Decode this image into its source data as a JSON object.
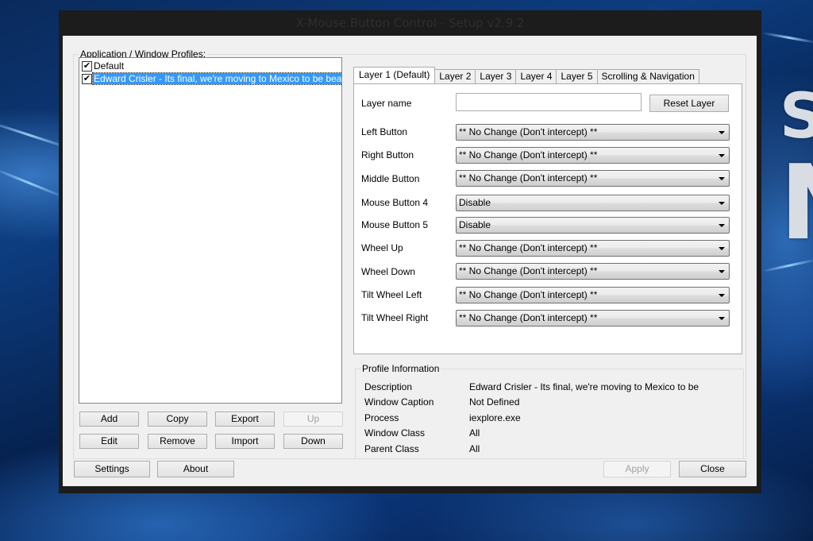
{
  "window": {
    "title": "X-Mouse Button Control - Setup v2.9.2"
  },
  "background": {
    "decor_letters": [
      "S",
      "N"
    ]
  },
  "profiles": {
    "group_label": "Application / Window Profiles:",
    "items": [
      {
        "label": "Default",
        "checked": true,
        "selected": false
      },
      {
        "label": "Edward Crisler - Its final, we're moving to Mexico to be beach bums",
        "checked": true,
        "selected": true
      }
    ],
    "buttons": {
      "add": "Add",
      "copy": "Copy",
      "export": "Export",
      "up": "Up",
      "edit": "Edit",
      "remove": "Remove",
      "import": "Import",
      "down": "Down"
    }
  },
  "tabs": [
    {
      "label": "Layer 1 (Default)",
      "active": true
    },
    {
      "label": "Layer 2",
      "active": false
    },
    {
      "label": "Layer 3",
      "active": false
    },
    {
      "label": "Layer 4",
      "active": false
    },
    {
      "label": "Layer 5",
      "active": false
    },
    {
      "label": "Scrolling & Navigation",
      "active": false
    }
  ],
  "layer": {
    "name_label": "Layer name",
    "name_value": "",
    "reset_button": "Reset Layer",
    "mappings": [
      {
        "label": "Left Button",
        "value": "** No Change (Don't intercept) **"
      },
      {
        "label": "Right Button",
        "value": "** No Change (Don't intercept) **"
      },
      {
        "label": "Middle Button",
        "value": "** No Change (Don't intercept) **"
      },
      {
        "label": "Mouse Button 4",
        "value": "Disable"
      },
      {
        "label": "Mouse Button 5",
        "value": "Disable"
      },
      {
        "label": "Wheel Up",
        "value": "** No Change (Don't intercept) **"
      },
      {
        "label": "Wheel Down",
        "value": "** No Change (Don't intercept) **"
      },
      {
        "label": "Tilt Wheel Left",
        "value": "** No Change (Don't intercept) **"
      },
      {
        "label": "Tilt Wheel Right",
        "value": "** No Change (Don't intercept) **"
      }
    ]
  },
  "profile_info": {
    "group_label": "Profile Information",
    "rows": [
      {
        "label": "Description",
        "value": "Edward Crisler - Its final, we're moving to Mexico to be"
      },
      {
        "label": "Window Caption",
        "value": "Not Defined"
      },
      {
        "label": "Process",
        "value": "iexplore.exe"
      },
      {
        "label": "Window Class",
        "value": "All"
      },
      {
        "label": "Parent Class",
        "value": "All"
      }
    ]
  },
  "footer": {
    "settings": "Settings",
    "about": "About",
    "apply": "Apply",
    "close": "Close"
  }
}
